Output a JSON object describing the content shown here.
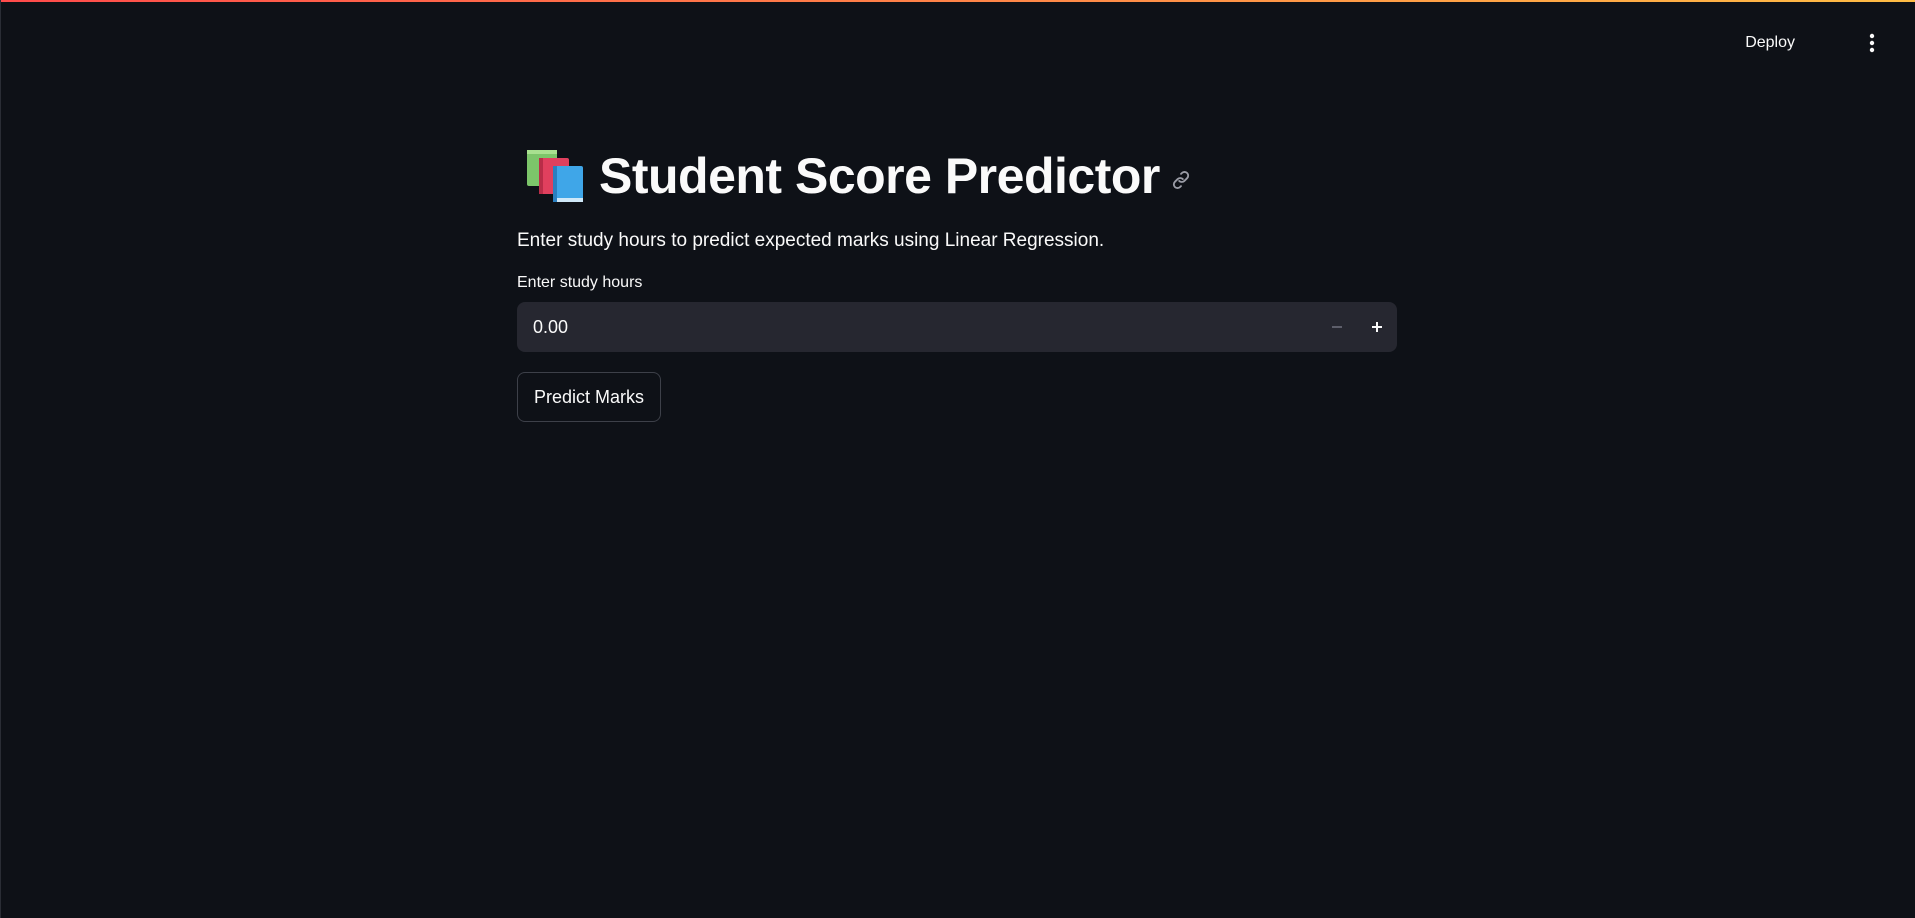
{
  "header": {
    "deploy_label": "Deploy",
    "menu_icon": "vertical-ellipsis-icon"
  },
  "main": {
    "title_icon": "books-emoji-icon",
    "title": "Student Score Predictor",
    "anchor_icon": "link-icon",
    "description": "Enter study hours to predict expected marks using Linear Regression.",
    "hours_input": {
      "label": "Enter study hours",
      "value": "0.00",
      "decrement_icon": "minus-icon",
      "increment_icon": "plus-icon"
    },
    "predict_button_label": "Predict Marks"
  },
  "colors": {
    "background": "#0e1117",
    "input_background": "#262730",
    "text": "#fafafa",
    "accent_gradient_start": "#ff4b4b",
    "accent_gradient_end": "#ffbd45"
  }
}
